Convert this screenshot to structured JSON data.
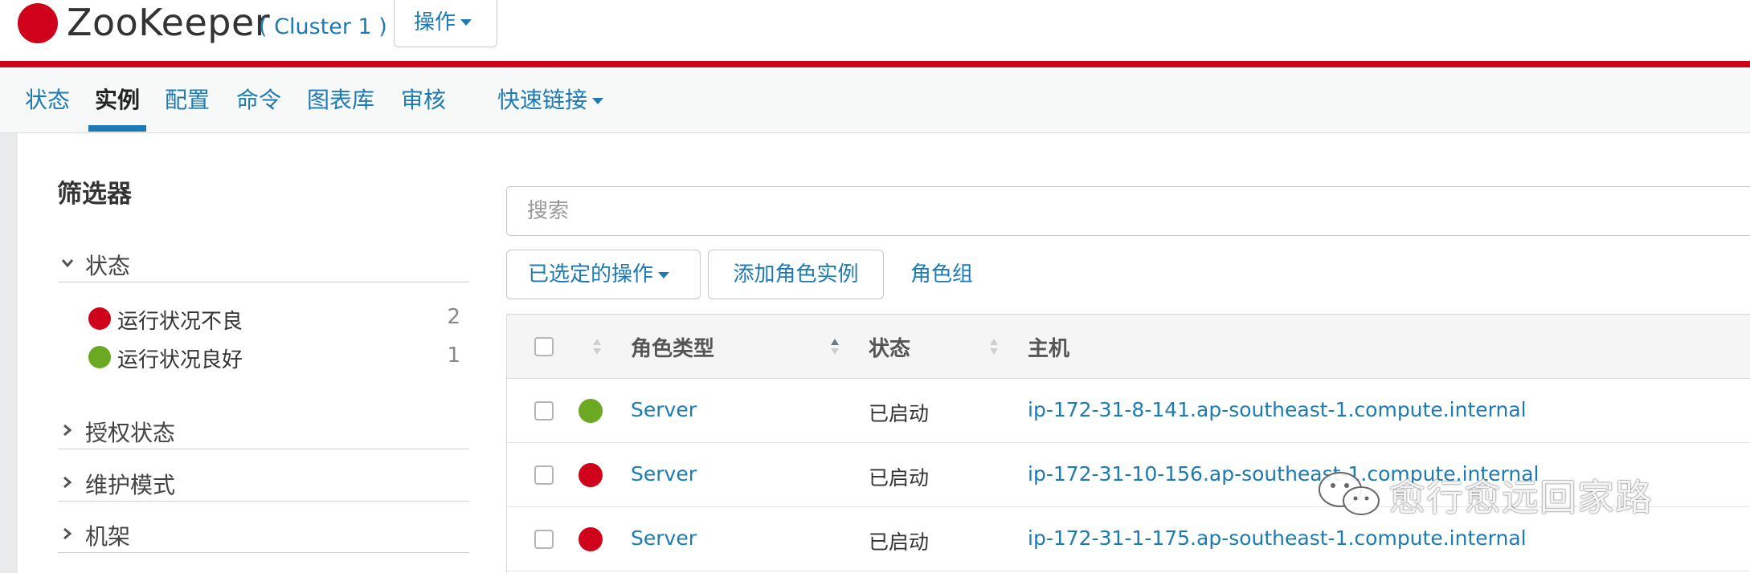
{
  "header": {
    "app_title": "ZooKeeper",
    "cluster_label": "( Cluster 1 )",
    "actions_label": "操作",
    "brand_color": "#d0021b",
    "accent_color": "#1e7ab3"
  },
  "tabs": [
    {
      "label": "状态",
      "active": false
    },
    {
      "label": "实例",
      "active": true
    },
    {
      "label": "配置",
      "active": false
    },
    {
      "label": "命令",
      "active": false
    },
    {
      "label": "图表库",
      "active": false
    },
    {
      "label": "审核",
      "active": false
    },
    {
      "label": "快速链接",
      "active": false
    }
  ],
  "filters": {
    "title": "筛选器",
    "status_facet": {
      "label": "状态",
      "items": [
        {
          "label": "运行状况不良",
          "count": "2",
          "color": "#d0021b"
        },
        {
          "label": "运行状况良好",
          "count": "1",
          "color": "#6aa921"
        }
      ]
    },
    "collapsed_facets": [
      "授权状态",
      "维护模式",
      "机架"
    ]
  },
  "search": {
    "placeholder": "搜索",
    "value": ""
  },
  "actions": {
    "selected_actions": "已选定的操作",
    "add_role_instance": "添加角色实例",
    "role_groups": "角色组"
  },
  "table": {
    "columns": [
      "角色类型",
      "状态",
      "主机"
    ],
    "rows": [
      {
        "health": "good",
        "health_color": "#6aa921",
        "role_type": "Server",
        "status": "已启动",
        "host": "ip-172-31-8-141.ap-southeast-1.compute.internal"
      },
      {
        "health": "bad",
        "health_color": "#d0021b",
        "role_type": "Server",
        "status": "已启动",
        "host": "ip-172-31-10-156.ap-southeast-1.compute.internal"
      },
      {
        "health": "bad",
        "health_color": "#d0021b",
        "role_type": "Server",
        "status": "已启动",
        "host": "ip-172-31-1-175.ap-southeast-1.compute.internal"
      }
    ]
  },
  "watermark": {
    "text": "愈行愈远回家路"
  }
}
